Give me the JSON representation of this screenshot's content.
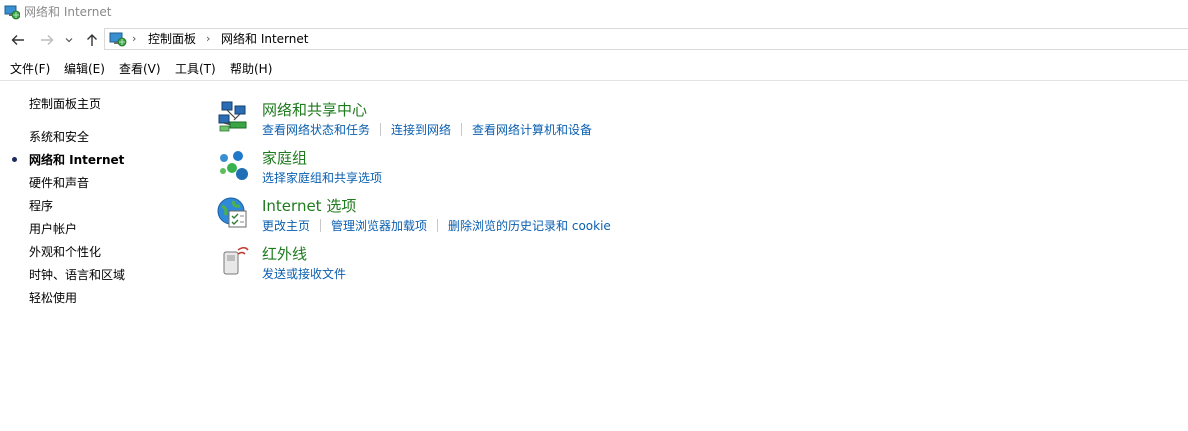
{
  "window": {
    "title": "网络和 Internet"
  },
  "address": {
    "crumbs": [
      "控制面板",
      "网络和 Internet"
    ]
  },
  "menu": [
    "文件(F)",
    "编辑(E)",
    "查看(V)",
    "工具(T)",
    "帮助(H)"
  ],
  "sidebar": {
    "home": "控制面板主页",
    "items": [
      "系统和安全",
      "网络和 Internet",
      "硬件和声音",
      "程序",
      "用户帐户",
      "外观和个性化",
      "时钟、语言和区域",
      "轻松使用"
    ],
    "active_index": 1
  },
  "categories": [
    {
      "title": "网络和共享中心",
      "icon": "network-sharing-icon",
      "links": [
        "查看网络状态和任务",
        "连接到网络",
        "查看网络计算机和设备"
      ]
    },
    {
      "title": "家庭组",
      "icon": "homegroup-icon",
      "links": [
        "选择家庭组和共享选项"
      ]
    },
    {
      "title": "Internet 选项",
      "icon": "internet-options-icon",
      "links": [
        "更改主页",
        "管理浏览器加载项",
        "删除浏览的历史记录和 cookie"
      ]
    },
    {
      "title": "红外线",
      "icon": "infrared-icon",
      "links": [
        "发送或接收文件"
      ]
    }
  ],
  "colors": {
    "category_title": "#1e7b1e",
    "link": "#0a5fb0",
    "title_text": "#8a8a8a"
  }
}
